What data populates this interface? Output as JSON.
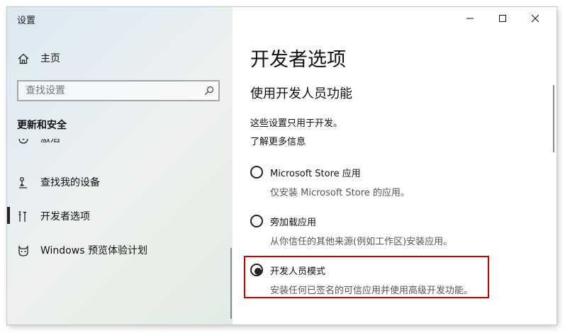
{
  "window": {
    "title": "设置"
  },
  "sidebar": {
    "home_label": "主页",
    "search_placeholder": "查找设置",
    "section_title": "更新和安全",
    "items": [
      {
        "label": "激活",
        "icon": "activation-icon"
      },
      {
        "label": "查找我的设备",
        "icon": "find-device-icon"
      },
      {
        "label": "开发者选项",
        "icon": "developer-tools-icon",
        "selected": true
      },
      {
        "label": "Windows 预览体验计划",
        "icon": "insider-cat-icon"
      }
    ]
  },
  "content": {
    "page_title": "开发者选项",
    "section_title": "使用开发人员功能",
    "description": "这些设置只用于开发。",
    "learn_more": "了解更多信息",
    "options": [
      {
        "label": "Microsoft Store 应用",
        "description": "仅安装 Microsoft Store 的应用。",
        "selected": false
      },
      {
        "label": "旁加载应用",
        "description": "从你信任的其他来源(例如工作区)安装应用。",
        "selected": false
      },
      {
        "label": "开发人员模式",
        "description": "安装任何已签名的可信应用并使用高级开发功能。",
        "selected": true
      }
    ]
  },
  "colors": {
    "highlight": "#d00000",
    "text": "#111111",
    "muted": "#555555"
  }
}
